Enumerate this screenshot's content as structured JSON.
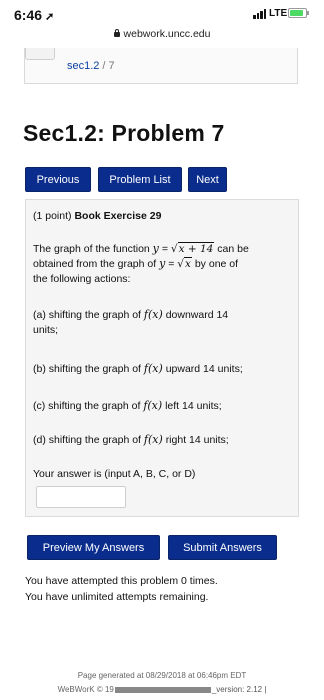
{
  "status_bar": {
    "time": "6:46",
    "carrier": "LTE"
  },
  "url_bar": {
    "domain": "webwork.uncc.edu"
  },
  "breadcrumb": {
    "set": "sec1.2",
    "separator": "/",
    "count": "7"
  },
  "page_title": "Sec1.2: Problem 7",
  "nav_buttons": {
    "previous": "Previous",
    "problem_list": "Problem List",
    "next": "Next"
  },
  "problem": {
    "points": "(1 point)",
    "exercise": "Book Exercise 29",
    "intro_a": "The graph of the function",
    "intro_y": "y",
    "intro_eq": "=",
    "intro_radicand": "x + 14",
    "intro_b": "can be",
    "intro_c": "obtained from the graph of",
    "intro_c2_y": "y",
    "intro_c2_eq": "=",
    "intro_c2_radicand": "x",
    "intro_d": "by one of",
    "intro_e": "the following actions:",
    "option_a_prefix": "(a) shifting the graph of",
    "option_a_fx": "f(x)",
    "option_a_suffix": "downward 14",
    "option_a_line2": "units;",
    "option_b_prefix": "(b) shifting the graph of",
    "option_b_fx": "f(x)",
    "option_b_suffix": "upward 14 units;",
    "option_c_prefix": "(c) shifting the graph of",
    "option_c_fx": "f(x)",
    "option_c_suffix": "left 14 units;",
    "option_d_prefix": "(d) shifting the graph of",
    "option_d_fx": "f(x)",
    "option_d_suffix": "right 14 units;",
    "answer_prompt": "Your answer is (input A, B, C, or D)",
    "answer_value": ""
  },
  "actions": {
    "preview": "Preview My Answers",
    "submit": "Submit Answers"
  },
  "attempts": {
    "line1": "You have attempted this problem 0 times.",
    "line2": "You have unlimited attempts remaining."
  },
  "footer": {
    "generated": "Page generated at 08/29/2018 at 06:46pm EDT",
    "copyright_start": "WeBWorK © 19",
    "version_end": "_version: 2.12 |"
  },
  "colors": {
    "button_bg": "#0a2c8c",
    "link": "#0b3fa3",
    "battery": "#4cd964"
  }
}
